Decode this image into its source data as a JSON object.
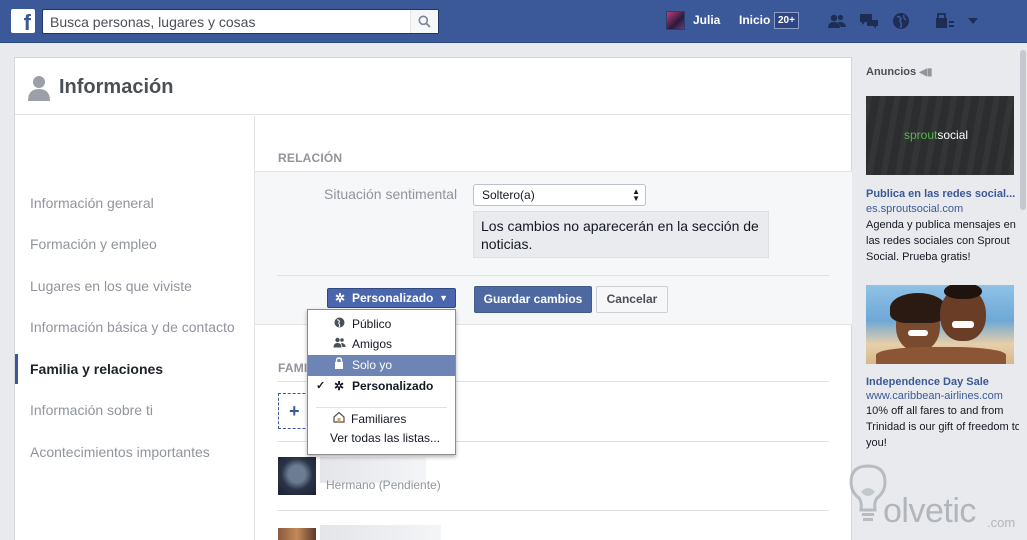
{
  "colors": {
    "brand": "#3b5998",
    "highlight": "#6d84b4",
    "link": "#3b5998",
    "muted": "#90949c"
  },
  "topbar": {
    "logo": "f",
    "search_placeholder": "Busca personas, lugares y cosas",
    "user_name": "Julia",
    "home_label": "Inicio",
    "home_badge": "20+",
    "icons": [
      "friend-requests-icon",
      "messages-icon",
      "notifications-globe-icon",
      "privacy-shortcuts-icon",
      "settings-menu-icon"
    ]
  },
  "page": {
    "title": "Información"
  },
  "sidebar": {
    "items": [
      {
        "label": "Información general",
        "active": false
      },
      {
        "label": "Formación y empleo",
        "active": false
      },
      {
        "label": "Lugares en los que viviste",
        "active": false
      },
      {
        "label": "Información básica y de contacto",
        "active": false
      },
      {
        "label": "Familia y relaciones",
        "active": true
      },
      {
        "label": "Información sobre ti",
        "active": false
      },
      {
        "label": "Acontecimientos importantes",
        "active": false
      }
    ]
  },
  "relation": {
    "section_title": "RELACIÓN",
    "field_label": "Situación sentimental",
    "selected_value": "Soltero(a)",
    "notice": "Los cambios no aparecerán en la sección de noticias.",
    "privacy_button": "Personalizado",
    "save_label": "Guardar cambios",
    "cancel_label": "Cancelar"
  },
  "privacy_menu": {
    "items": [
      {
        "label": "Público",
        "icon": "globe-icon",
        "highlighted": false,
        "checked": false
      },
      {
        "label": "Amigos",
        "icon": "friends-icon",
        "highlighted": false,
        "checked": false
      },
      {
        "label": "Solo yo",
        "icon": "lock-icon",
        "highlighted": true,
        "checked": false
      },
      {
        "label": "Personalizado",
        "icon": "gear-icon",
        "highlighted": false,
        "checked": true
      }
    ],
    "lists": [
      {
        "label": "Familiares",
        "icon": "house-icon"
      }
    ],
    "see_all": "Ver todas las listas..."
  },
  "family": {
    "section_title": "FAMI",
    "add_symbol": "+",
    "members": [
      {
        "relation": "Hermano (Pendiente)"
      }
    ]
  },
  "ads": {
    "header": "Anuncios",
    "items": [
      {
        "brand_part1": "sprout",
        "brand_part2": "social",
        "title": "Publica en las redes social...",
        "url": "es.sproutsocial.com",
        "text": "Agenda y publica mensajes en las redes sociales con Sprout Social. Prueba gratis!"
      },
      {
        "title": "Independence Day Sale",
        "url": "www.caribbean-airlines.com",
        "text": "10% off all fares to and from Trinidad is our gift of freedom to you!"
      }
    ]
  },
  "watermark": {
    "text": "olvetic",
    "suffix": ".com"
  }
}
